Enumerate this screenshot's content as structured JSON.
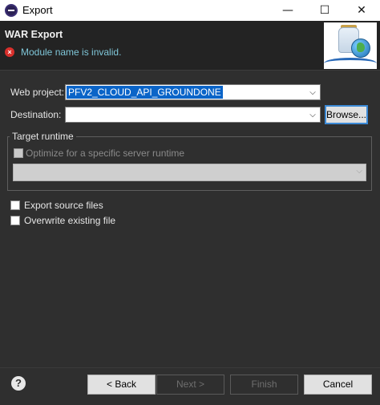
{
  "window": {
    "title": "Export",
    "minimize_glyph": "—",
    "maximize_glyph": "☐",
    "close_glyph": "✕"
  },
  "header": {
    "title": "WAR Export",
    "error_glyph": "×",
    "error_message": "Module name is invalid."
  },
  "form": {
    "web_project_label": "Web project:",
    "web_project_value": "PFV2_CLOUD_API_GROUNDONE",
    "destination_label": "Destination:",
    "destination_value": "",
    "browse_label": "Browse...",
    "dropdown_glyph": "⌵"
  },
  "target_runtime": {
    "group_label": "Target runtime",
    "optimize_label": "Optimize for a specific server runtime",
    "optimize_checked": false,
    "runtime_value": ""
  },
  "options": {
    "export_source_label": "Export source files",
    "export_source_checked": false,
    "overwrite_label": "Overwrite existing file",
    "overwrite_checked": false
  },
  "footer": {
    "help_glyph": "?",
    "back_label": "< Back",
    "next_label": "Next >",
    "finish_label": "Finish",
    "cancel_label": "Cancel"
  },
  "colors": {
    "background": "#2f2f2f",
    "banner": "#232323",
    "error_text": "#7fc6d8",
    "selection": "#0a64c8",
    "focus_border": "#3c8ad6"
  },
  "icons": [
    "app-icon",
    "error-icon",
    "war-export-wizard-icon",
    "dropdown-arrow-icon",
    "help-icon"
  ]
}
